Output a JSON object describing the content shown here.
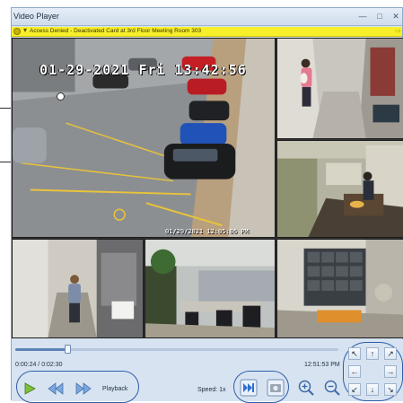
{
  "window": {
    "title": "Video Player",
    "buttons": [
      "minimize-icon",
      "maximize-icon",
      "close-icon"
    ]
  },
  "alert": {
    "text": "Access Denied - Deactivated Card at 3rd Floor Meeting Room 303",
    "color": "#f7ef2a"
  },
  "cameras": {
    "main": {
      "overlay_timestamp": "01-29-2021 Fri 13:42:56",
      "bottom_timestamp": "01/29/2021 12:05:06 PM"
    }
  },
  "playback": {
    "current_time": "0:00:24 / 0:02:30",
    "clock": "12:51:53 PM",
    "progress": 0.16,
    "label": "Playback",
    "speed_label": "Speed: 1x"
  },
  "icons": {
    "play": "play-icon",
    "rewind": "rewind-icon",
    "forward": "fast-forward-icon",
    "speed": "speed-icon",
    "snapshot": "snapshot-icon",
    "zoom_in": "zoom-in-icon",
    "zoom_out": "zoom-out-icon",
    "ptz": [
      "↖",
      "↑",
      "↗",
      "←",
      "→",
      "↙",
      "↓",
      "↘"
    ]
  },
  "colors": {
    "accent": "#2e5ea8",
    "window_bg": "#d7e3f1"
  }
}
